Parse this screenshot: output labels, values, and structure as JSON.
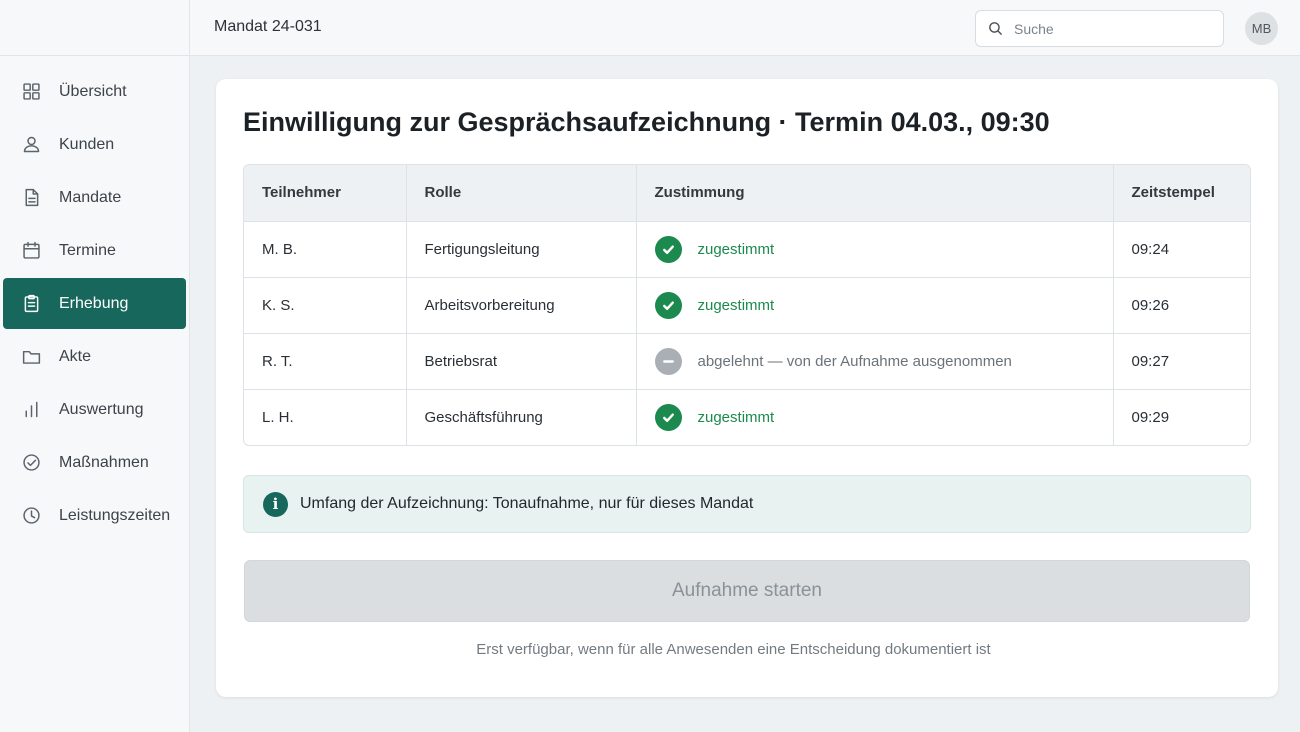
{
  "header": {
    "mandate_title": "Mandat 24-031",
    "search_placeholder": "Suche",
    "avatar_initials": "MB"
  },
  "sidebar": {
    "items": [
      {
        "label": "Übersicht",
        "icon": "grid-icon",
        "active": false
      },
      {
        "label": "Kunden",
        "icon": "person-icon",
        "active": false
      },
      {
        "label": "Mandate",
        "icon": "document-icon",
        "active": false
      },
      {
        "label": "Termine",
        "icon": "calendar-icon",
        "active": false
      },
      {
        "label": "Erhebung",
        "icon": "clipboard-icon",
        "active": true
      },
      {
        "label": "Akte",
        "icon": "folder-icon",
        "active": false
      },
      {
        "label": "Auswertung",
        "icon": "bar-chart-icon",
        "active": false
      },
      {
        "label": "Maßnahmen",
        "icon": "check-circle-icon",
        "active": false
      },
      {
        "label": "Leistungszeiten",
        "icon": "clock-icon",
        "active": false
      }
    ]
  },
  "main": {
    "title": "Einwilligung zur Gesprächsaufzeichnung · Termin 04.03., 09:30",
    "table": {
      "columns": [
        "Teilnehmer",
        "Rolle",
        "Zustimmung",
        "Zeitstempel"
      ],
      "rows": [
        {
          "participant": "M. B.",
          "role": "Fertigungsleitung",
          "consent": "zugestimmt",
          "status": "approved",
          "time": "09:24"
        },
        {
          "participant": "K. S.",
          "role": "Arbeitsvorbereitung",
          "consent": "zugestimmt",
          "status": "approved",
          "time": "09:26"
        },
        {
          "participant": "R. T.",
          "role": "Betriebsrat",
          "consent": "abgelehnt — von der Aufnahme ausgenommen",
          "status": "declined",
          "time": "09:27"
        },
        {
          "participant": "L. H.",
          "role": "Geschäftsführung",
          "consent": "zugestimmt",
          "status": "approved",
          "time": "09:29"
        }
      ]
    },
    "info_text": "Umfang der Aufzeichnung: Tonaufnahme, nur für dieses Mandat",
    "start_button_label": "Aufnahme starten",
    "hint": "Erst verfügbar, wenn für alle Anwesenden eine Entscheidung dokumentiert ist"
  },
  "colors": {
    "accent": "#17675d",
    "approved": "#1c8a4e",
    "declined": "#a9afb4"
  }
}
